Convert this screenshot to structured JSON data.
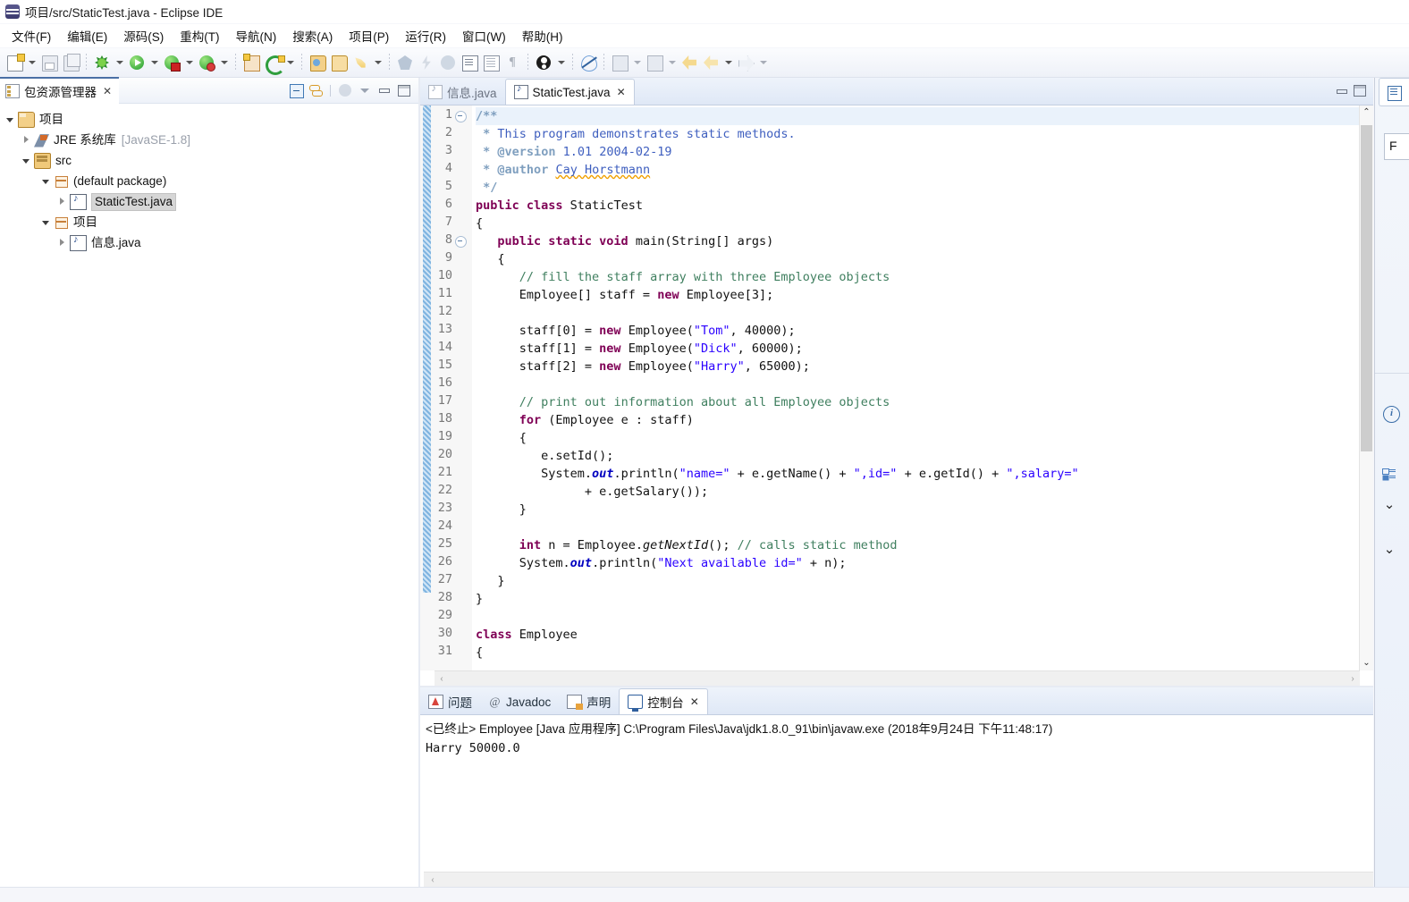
{
  "window": {
    "title": "项目/src/StaticTest.java - Eclipse IDE",
    "icon": "eclipse-icon"
  },
  "menubar": {
    "items": [
      {
        "label": "文件(F)",
        "name": "menu-file"
      },
      {
        "label": "编辑(E)",
        "name": "menu-edit"
      },
      {
        "label": "源码(S)",
        "name": "menu-source"
      },
      {
        "label": "重构(T)",
        "name": "menu-refactor"
      },
      {
        "label": "导航(N)",
        "name": "menu-navigate"
      },
      {
        "label": "搜索(A)",
        "name": "menu-search"
      },
      {
        "label": "项目(P)",
        "name": "menu-project"
      },
      {
        "label": "运行(R)",
        "name": "menu-run"
      },
      {
        "label": "窗口(W)",
        "name": "menu-window"
      },
      {
        "label": "帮助(H)",
        "name": "menu-help"
      }
    ]
  },
  "toolbar": {
    "icons": [
      "new-file-icon",
      "dropdown-arrow-icon",
      "save-icon",
      "save-all-icon",
      "separator",
      "debug-icon",
      "dropdown-arrow-icon",
      "run-icon",
      "dropdown-arrow-icon",
      "external-tools-icon",
      "dropdown-arrow-icon",
      "coverage-icon",
      "dropdown-arrow-icon",
      "separator",
      "new-java-class-icon",
      "refresh-icon",
      "dropdown-arrow-icon",
      "separator",
      "open-type-icon",
      "open-task-icon",
      "launch-icon",
      "dropdown-arrow-icon",
      "separator",
      "search-icon",
      "search-dim-icon",
      "bolt-icon",
      "bug-icon",
      "document-icon",
      "document-lines-icon",
      "pilcrow-icon",
      "separator",
      "person-icon",
      "dropdown-arrow-icon",
      "separator",
      "no-eye-icon",
      "separator",
      "previous-annotation-icon",
      "dropdown-arrow-icon",
      "next-annotation-icon",
      "dropdown-arrow-icon",
      "back-icon",
      "forward-back-icon",
      "dropdown-arrow-icon",
      "forward-icon",
      "dropdown-arrow-icon"
    ]
  },
  "explorer": {
    "tab_label": "包资源管理器",
    "tab_icon": "package-explorer-icon",
    "close_icon": "✕",
    "tools": [
      "collapse-all-icon",
      "link-with-editor-icon",
      "focus-icon",
      "view-menu-icon",
      "minimize-icon",
      "maximize-icon"
    ],
    "tree": [
      {
        "label": "项目",
        "icon": "project-icon",
        "twisty": "open",
        "indent": 0,
        "selected": false,
        "suffix": ""
      },
      {
        "label": "JRE 系统库",
        "icon": "jre-library-icon",
        "twisty": "closed",
        "indent": 1,
        "selected": false,
        "suffix": "[JavaSE-1.8]"
      },
      {
        "label": "src",
        "icon": "source-folder-icon",
        "twisty": "open",
        "indent": 1,
        "selected": false,
        "suffix": ""
      },
      {
        "label": "(default package)",
        "icon": "package-icon",
        "twisty": "open",
        "indent": 2,
        "selected": false,
        "suffix": ""
      },
      {
        "label": "StaticTest.java",
        "icon": "java-file-icon",
        "twisty": "closed",
        "indent": 3,
        "selected": true,
        "suffix": ""
      },
      {
        "label": "项目",
        "icon": "package-icon",
        "twisty": "open",
        "indent": 2,
        "selected": false,
        "suffix": ""
      },
      {
        "label": "信息.java",
        "icon": "java-file-icon",
        "twisty": "closed",
        "indent": 3,
        "selected": false,
        "suffix": ""
      }
    ]
  },
  "editor": {
    "tabs": [
      {
        "label": "信息.java",
        "active": false,
        "closable": false
      },
      {
        "label": "StaticTest.java",
        "active": true,
        "closable": true,
        "close_icon": "✕"
      }
    ],
    "window_buttons": [
      "minimize-icon",
      "maximize-icon"
    ],
    "first_line": 1,
    "last_line": 31,
    "folding_lines": [
      1,
      8
    ],
    "highlighted_line": 1,
    "scroll": {
      "up_icon": "⌃",
      "down_icon": "⌄",
      "left_icon": "‹",
      "right_icon": "›"
    },
    "lines": [
      {
        "n": 1,
        "html": "<span class='jdt'>/**</span>"
      },
      {
        "n": 2,
        "html": " <span class='jdt'>*</span> <span class='jd'>This program demonstrates static methods.</span>"
      },
      {
        "n": 3,
        "html": " <span class='jdt'>*</span> <span class='jdt'>@version</span> <span class='jd'>1.01 2004-02-19</span>"
      },
      {
        "n": 4,
        "html": " <span class='jdt'>*</span> <span class='jdt'>@author</span> <span class='jd sq'>Cay Horstmann</span>"
      },
      {
        "n": 5,
        "html": " <span class='jdt'>*/</span>"
      },
      {
        "n": 6,
        "html": "<span class='kw'>public class</span> StaticTest"
      },
      {
        "n": 7,
        "html": "{"
      },
      {
        "n": 8,
        "html": "   <span class='kw'>public static void</span> main(String[] args)"
      },
      {
        "n": 9,
        "html": "   {"
      },
      {
        "n": 10,
        "html": "      <span class='cm'>// fill the staff array with three Employee objects</span>"
      },
      {
        "n": 11,
        "html": "      Employee[] staff = <span class='kw'>new</span> Employee[3];"
      },
      {
        "n": 12,
        "html": ""
      },
      {
        "n": 13,
        "html": "      staff[0] = <span class='kw'>new</span> Employee(<span class='st'>\"Tom\"</span>, 40000);"
      },
      {
        "n": 14,
        "html": "      staff[1] = <span class='kw'>new</span> Employee(<span class='st'>\"Dick\"</span>, 60000);"
      },
      {
        "n": 15,
        "html": "      staff[2] = <span class='kw'>new</span> Employee(<span class='st'>\"Harry\"</span>, 65000);"
      },
      {
        "n": 16,
        "html": ""
      },
      {
        "n": 17,
        "html": "      <span class='cm'>// print out information about all Employee objects</span>"
      },
      {
        "n": 18,
        "html": "      <span class='kw'>for</span> (Employee e : staff)"
      },
      {
        "n": 19,
        "html": "      {"
      },
      {
        "n": 20,
        "html": "         e.setId();"
      },
      {
        "n": 21,
        "html": "         System.<span class='sf'>out</span>.println(<span class='st'>\"name=\"</span> + e.getName() + <span class='st'>\",id=\"</span> + e.getId() + <span class='st'>\",salary=\"</span>"
      },
      {
        "n": 22,
        "html": "               + e.getSalary());"
      },
      {
        "n": 23,
        "html": "      }"
      },
      {
        "n": 24,
        "html": ""
      },
      {
        "n": 25,
        "html": "      <span class='kw'>int</span> n = Employee.<span class='it'>getNextId</span>(); <span class='cm'>// calls static method</span>"
      },
      {
        "n": 26,
        "html": "      System.<span class='sf'>out</span>.println(<span class='st'>\"Next available id=\"</span> + n);"
      },
      {
        "n": 27,
        "html": "   }"
      },
      {
        "n": 28,
        "html": "}"
      },
      {
        "n": 29,
        "html": ""
      },
      {
        "n": 30,
        "html": "<span class='kw'>class</span> Employee"
      },
      {
        "n": 31,
        "html": "{"
      }
    ],
    "plain_lines": [
      "/**",
      " * This program demonstrates static methods.",
      " * @version 1.01 2004-02-19",
      " * @author Cay Horstmann",
      " */",
      "public class StaticTest",
      "{",
      "   public static void main(String[] args)",
      "   {",
      "      // fill the staff array with three Employee objects",
      "      Employee[] staff = new Employee[3];",
      "",
      "      staff[0] = new Employee(\"Tom\", 40000);",
      "      staff[1] = new Employee(\"Dick\", 60000);",
      "      staff[2] = new Employee(\"Harry\", 65000);",
      "",
      "      // print out information about all Employee objects",
      "      for (Employee e : staff)",
      "      {",
      "         e.setId();",
      "         System.out.println(\"name=\" + e.getName() + \",id=\" + e.getId() + \",salary=\"",
      "               + e.getSalary());",
      "      }",
      "",
      "      int n = Employee.getNextId(); // calls static method",
      "      System.out.println(\"Next available id=\" + n);",
      "   }",
      "}",
      "",
      "class Employee",
      "{"
    ]
  },
  "bottom_panel": {
    "tabs": [
      {
        "label": "问题",
        "icon": "problems-icon",
        "active": false
      },
      {
        "label": "Javadoc",
        "icon": "javadoc-at-icon",
        "active": false
      },
      {
        "label": "声明",
        "icon": "declaration-icon",
        "active": false
      },
      {
        "label": "控制台",
        "icon": "console-icon",
        "active": true,
        "close_icon": "✕"
      }
    ],
    "console": {
      "header": "<已终止> Employee [Java 应用程序] C:\\Program Files\\Java\\jdk1.8.0_91\\bin\\javaw.exe  (2018年9月24日 下午11:48:17)",
      "output": "Harry 50000.0"
    }
  },
  "rightbar": {
    "items": [
      "outline-doc-icon",
      "f-button",
      "info-icon",
      "outline-tree-icon",
      "chevron-down-icon",
      "chevron-down-icon"
    ],
    "f_label": "F",
    "info_label": "i",
    "chevron": "⌄"
  },
  "colors": {
    "keyword": "#7f0055",
    "string": "#2a00ff",
    "comment": "#3f7f5f",
    "javadoc": "#3f5fbf",
    "static_field": "#0000c0",
    "tab_accent": "#4a6fa5",
    "selection": "#d6d6d6",
    "highlight_line": "#eaf2fb"
  }
}
